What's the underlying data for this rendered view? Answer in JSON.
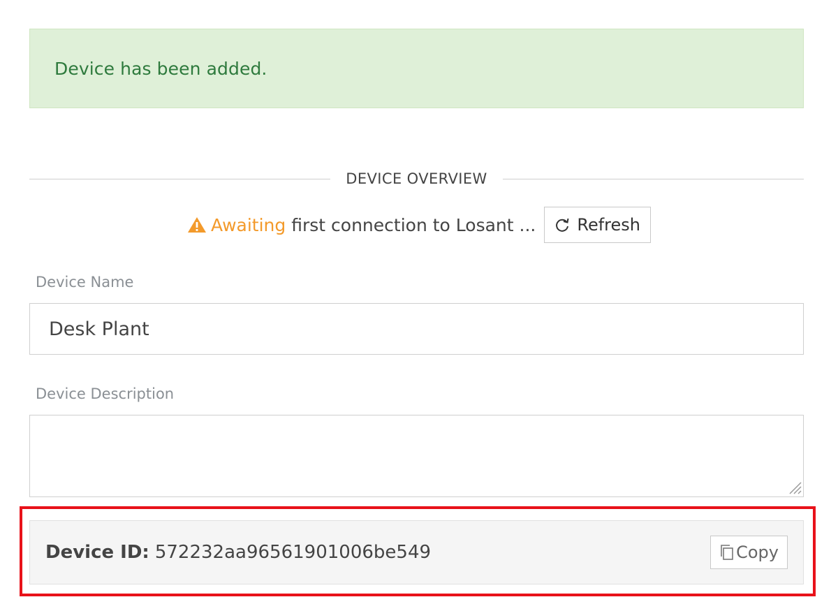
{
  "alert": {
    "message": "Device has been added."
  },
  "overview": {
    "title": "DEVICE OVERVIEW"
  },
  "status": {
    "icon": "warning-icon",
    "awaiting": "Awaiting",
    "message": "first connection to Losant ...",
    "refresh_label": "Refresh",
    "colors": {
      "warning": "#f39a2b"
    }
  },
  "form": {
    "name_label": "Device Name",
    "name_value": "Desk Plant",
    "description_label": "Device Description",
    "description_value": ""
  },
  "device_id": {
    "label": "Device ID:",
    "value": "572232aa96561901006be549",
    "copy_label": "Copy",
    "highlight_color": "#e8121a"
  },
  "colors": {
    "alert_bg": "#dff0d8",
    "alert_text": "#2e7a3d"
  }
}
